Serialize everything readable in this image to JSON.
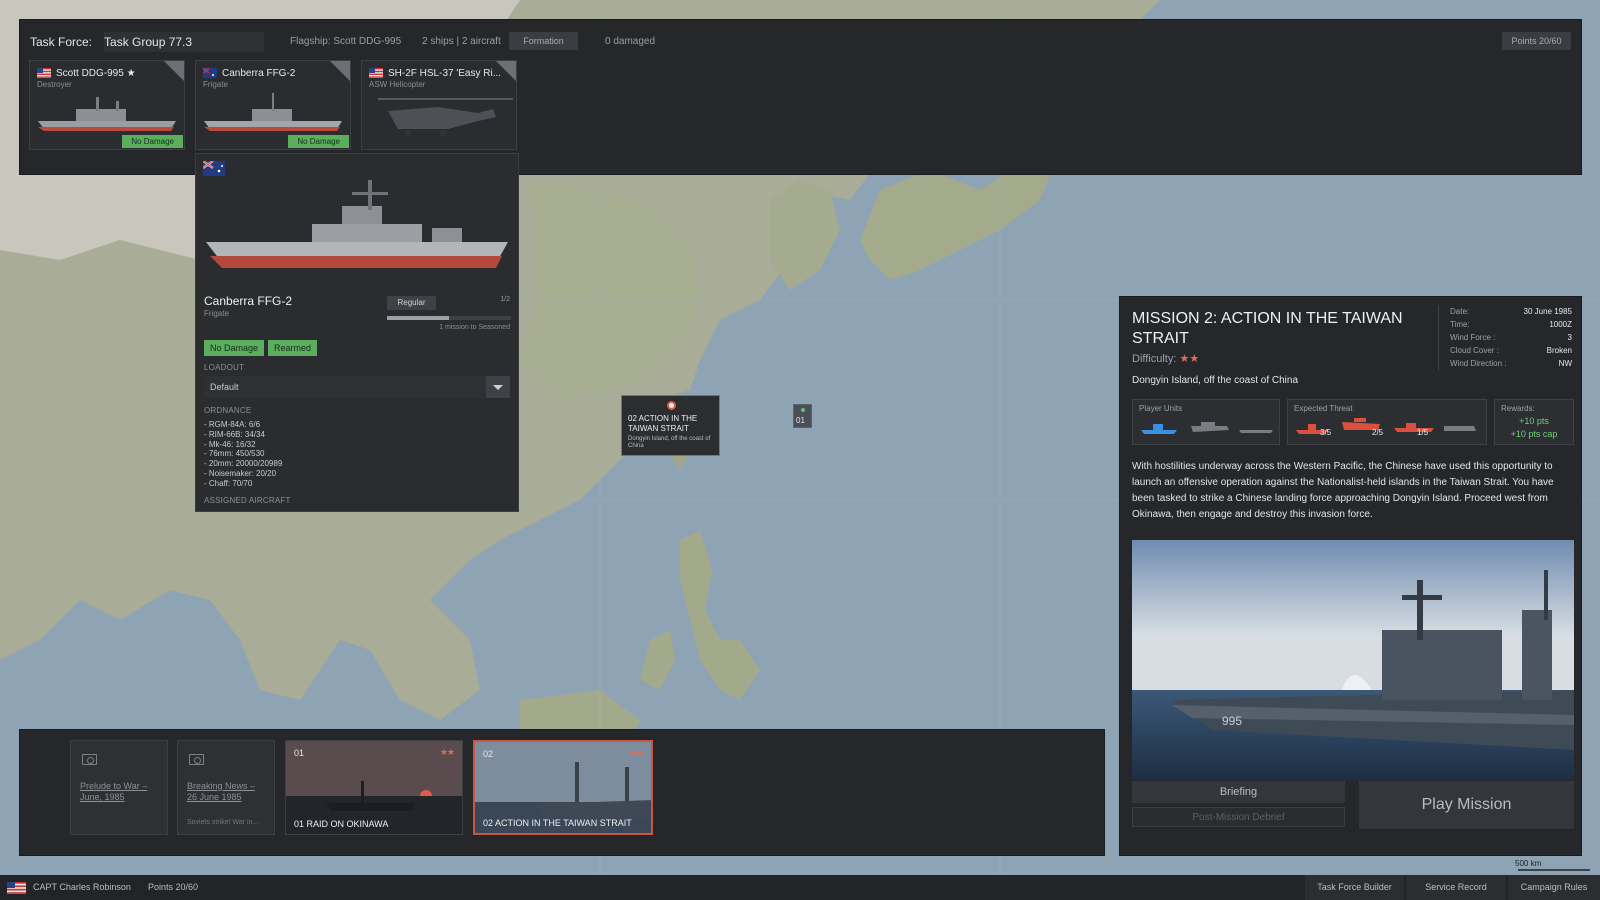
{
  "task_force": {
    "label": "Task Force:",
    "name": "Task Group 77.3",
    "flagship": "Flagship: Scott DDG-995",
    "counts": "2 ships | 2 aircraft",
    "formation_button": "Formation",
    "damaged": "0 damaged",
    "points": "Points 20/60"
  },
  "units": [
    {
      "name": "Scott DDG-995 ★",
      "class": "Destroyer",
      "status": "No Damage",
      "flag": "us-flag-icon"
    },
    {
      "name": "Canberra FFG-2",
      "class": "Frigate",
      "status": "No Damage",
      "flag": "au-flag-icon"
    },
    {
      "name": "SH-2F HSL-37 'Easy Ri...",
      "class": "ASW Helicopter",
      "flag": "us-flag-icon"
    }
  ],
  "ship_detail": {
    "name": "Canberra FFG-2",
    "class": "Frigate",
    "rank": "Regular",
    "progress": "1/2",
    "progress_fraction": 0.5,
    "progress_note": "1 mission to Seasoned",
    "status_tags": [
      "No Damage",
      "Rearmed"
    ],
    "loadout_label": "LOADOUT",
    "loadout_value": "Default",
    "ordnance_label": "ORDNANCE",
    "ordnance": [
      "RGM-84A: 6/6",
      "RIM-66B: 34/34",
      "Mk-46: 16/32",
      "76mm: 450/530",
      "20mm: 20000/20989",
      "Noisemaker: 20/20",
      "Chaff: 70/70"
    ],
    "aircraft_label": "ASSIGNED AIRCRAFT"
  },
  "map": {
    "marker_title": "02 ACTION IN THE TAIWAN STRAIT",
    "marker_sub": "Dongyin Island, off the coast of China",
    "marker2": "01",
    "scale": "500 km"
  },
  "mission": {
    "title": "MISSION 2: ACTION IN THE TAIWAN STRAIT",
    "difficulty_label": "Difficulty:",
    "difficulty_stars": "★★",
    "location": "Dongyin Island, off the coast of China",
    "conditions": [
      {
        "k": "Date:",
        "v": "30 June 1985"
      },
      {
        "k": "Time:",
        "v": "1000Z"
      },
      {
        "k": "Wind Force :",
        "v": "3"
      },
      {
        "k": "Cloud Cover :",
        "v": "Broken"
      },
      {
        "k": "Wind Direction :",
        "v": "NW"
      }
    ],
    "player_units_label": "Player Units",
    "threat_label": "Expected Threat",
    "threat_counts": [
      "3/5",
      "2/5",
      "1/5"
    ],
    "rewards_label": "Rewards:",
    "rewards": [
      "+10 pts",
      "+10 pts cap"
    ],
    "description": "With hostilities underway across the Western Pacific, the Chinese have used this opportunity to launch an offensive operation against the Nationalist-held islands in the Taiwan Strait. You have been tasked to strike a Chinese landing force approaching Dongyin Island. Proceed west from Okinawa, then engage and destroy this invasion force.",
    "briefing": "Briefing",
    "debrief": "Post-Mission Debrief",
    "play": "Play Mission"
  },
  "missions_bar": [
    {
      "title": "Prelude to War – June, 1985"
    },
    {
      "title": "Breaking News – 26 June 1985",
      "sub": "Soviets strike! War in..."
    },
    {
      "num": "01",
      "stars": "★★",
      "caption": "01 RAID ON OKINAWA"
    },
    {
      "num": "02",
      "stars": "★★",
      "caption": "02 ACTION IN THE TAIWAN STRAIT"
    }
  ],
  "bottom": {
    "player": "CAPT Charles Robinson",
    "points": "Points 20/60",
    "nav": [
      "Task Force Builder",
      "Service Record",
      "Campaign Rules"
    ]
  },
  "colors": {
    "accent_red": "#c9573f",
    "status_green": "#5cae5e",
    "panel": "#25272a"
  }
}
